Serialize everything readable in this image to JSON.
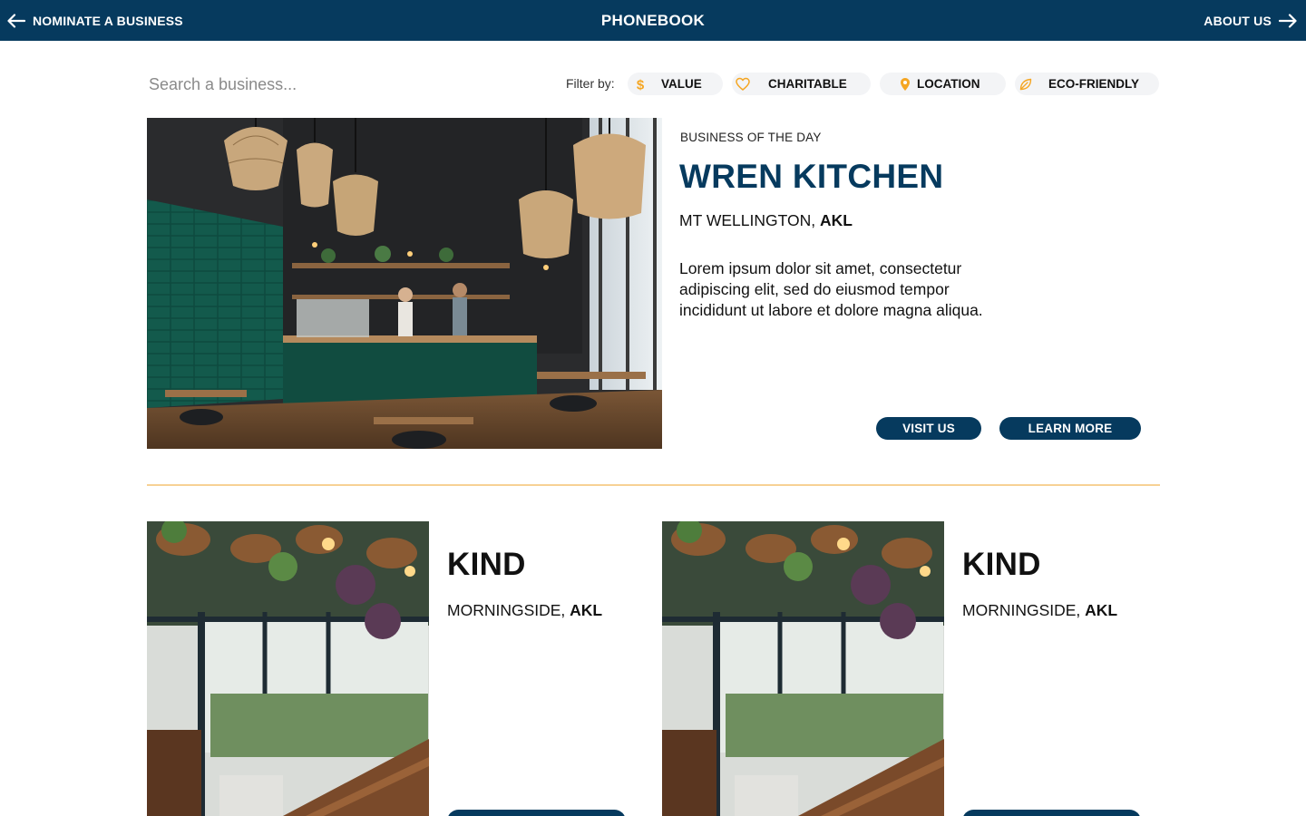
{
  "topbar": {
    "back_label": "NOMINATE A BUSINESS",
    "brand": "PHONEBOOK",
    "forward_label": "ABOUT US",
    "back_icon": "arrow-left-icon",
    "forward_icon": "arrow-right-icon"
  },
  "search": {
    "placeholder": "Search a business..."
  },
  "filters": {
    "label": "Filter by:",
    "items": [
      {
        "label": "VALUE",
        "icon": "dollar-icon"
      },
      {
        "label": "CHARITABLE",
        "icon": "heart-icon"
      },
      {
        "label": "LOCATION",
        "icon": "map-pin-icon"
      },
      {
        "label": "ECO-FRIENDLY",
        "icon": "leaf-icon"
      }
    ]
  },
  "featured": {
    "kicker": "BUSINESS OF THE DAY",
    "name": "WREN KITCHEN",
    "suburb": "MT WELLINGTON, ",
    "city": "AKL",
    "description": "Lorem ipsum dolor sit amet, consectetur adipiscing elit, sed do eiusmod tempor incididunt ut labore et dolore magna aliqua.",
    "visit_label": "VISIT US",
    "learn_label": "LEARN MORE"
  },
  "cards": [
    {
      "name": "KIND",
      "suburb": "MORNINGSIDE, ",
      "city": "AKL"
    },
    {
      "name": "KIND",
      "suburb": "MORNINGSIDE, ",
      "city": "AKL"
    }
  ],
  "colors": {
    "navy": "#063a5e",
    "accent": "#f5a623",
    "divider": "#f7d194",
    "chip_bg": "#f3f4f6"
  }
}
